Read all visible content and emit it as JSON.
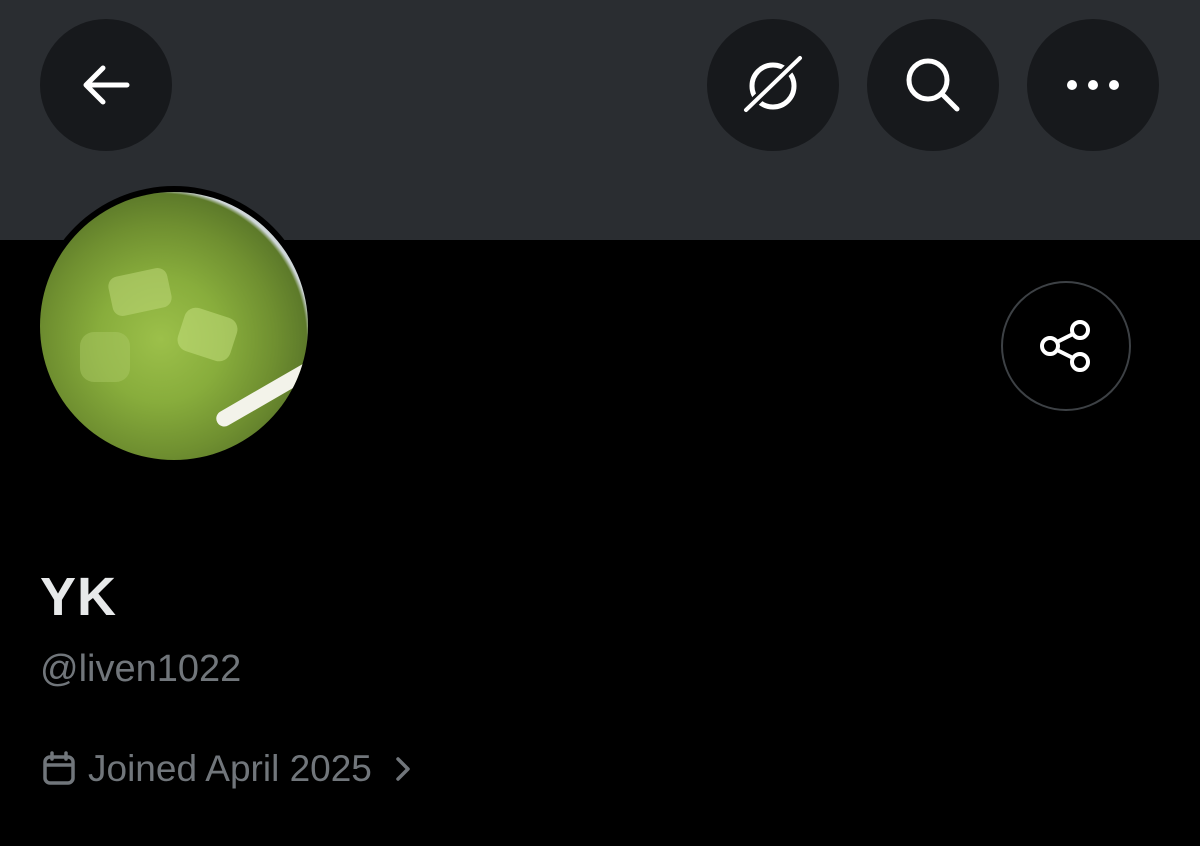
{
  "header": {
    "back_icon": "arrow-left-icon",
    "grok_icon": "grok-icon",
    "search_icon": "search-icon",
    "more_icon": "more-horizontal-icon"
  },
  "profile": {
    "display_name": "YK",
    "handle": "@liven1022",
    "joined": "Joined April 2025",
    "share_icon": "share-icon",
    "calendar_icon": "calendar-icon"
  },
  "colors": {
    "background": "#000000",
    "banner": "#2a2d31",
    "button_bg": "#17191c",
    "primary_text": "#e7e9ea",
    "secondary_text": "#71767b"
  }
}
